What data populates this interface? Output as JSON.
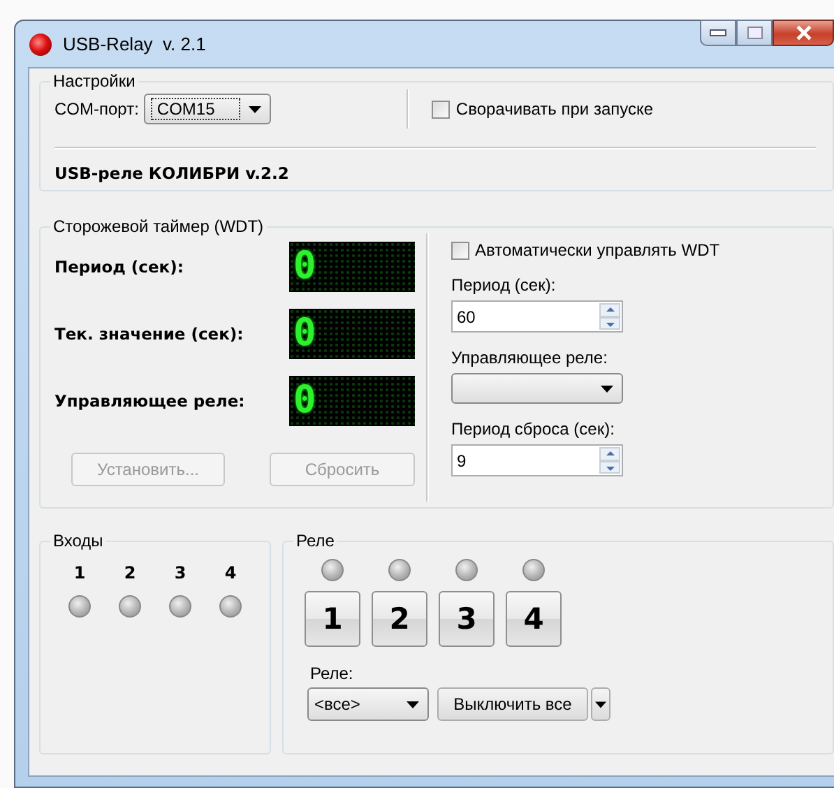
{
  "window": {
    "title": "USB-Relay  v. 2.1"
  },
  "settings": {
    "title": "Настройки",
    "com_port_label": "COM-порт:",
    "com_port_value": "COM15",
    "minimize_on_start": {
      "label": "Сворачивать при запуске",
      "checked": false
    },
    "device": "USB-реле КОЛИБРИ v.2.2"
  },
  "wdt": {
    "title": "Сторожевой таймер (WDT)",
    "displays": [
      {
        "label": "Период (сек):",
        "value": "0"
      },
      {
        "label": "Тек. значение (сек):",
        "value": "0"
      },
      {
        "label": "Управляющее реле:",
        "value": "0"
      }
    ],
    "buttons": [
      {
        "label": "Установить...",
        "disabled": true
      },
      {
        "label": "Сбросить",
        "disabled": true
      }
    ],
    "auto": {
      "label": "Автоматически управлять WDT",
      "checked": false
    },
    "fields": [
      {
        "kind": "spin",
        "label": "Период (сек):",
        "value": "60"
      },
      {
        "kind": "dropdown",
        "label": "Управляющее реле:"
      },
      {
        "kind": "spin",
        "label": "Период сброса (сек):",
        "value": "9"
      }
    ]
  },
  "inputs": {
    "title": "Входы",
    "items": [
      {
        "label": "1",
        "on": false
      },
      {
        "label": "2",
        "on": false
      },
      {
        "label": "3",
        "on": false
      },
      {
        "label": "4",
        "on": false
      }
    ]
  },
  "relays": {
    "title": "Реле",
    "items": [
      {
        "label": "1",
        "on": false
      },
      {
        "label": "2",
        "on": false
      },
      {
        "label": "3",
        "on": false
      },
      {
        "label": "4",
        "on": false
      }
    ],
    "select_label": "Реле:",
    "select_value": "<все>",
    "off_button": "Выключить все"
  }
}
